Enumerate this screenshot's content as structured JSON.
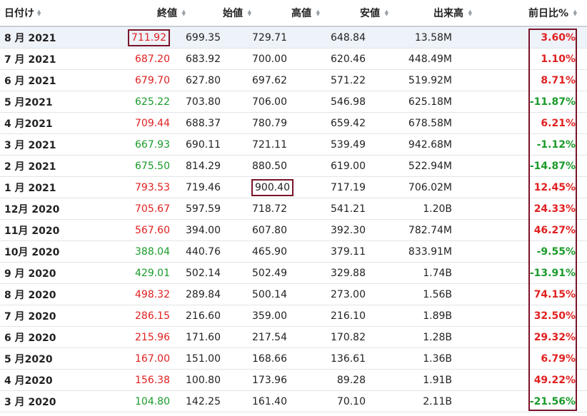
{
  "columns": {
    "date": "日付け",
    "close": "終値",
    "open": "始値",
    "high": "高値",
    "low": "安値",
    "volume": "出来高",
    "change": "前日比%"
  },
  "colors": {
    "up": "#e02020",
    "down": "#1a9a2a",
    "highlight_box": "#7a1428"
  },
  "rows": [
    {
      "date": "8 月 2021",
      "close": "711.92",
      "open": "699.35",
      "high": "729.71",
      "low": "648.84",
      "volume": "13.58M",
      "change": "3.60%",
      "dir": "up"
    },
    {
      "date": "7 月 2021",
      "close": "687.20",
      "open": "683.92",
      "high": "700.00",
      "low": "620.46",
      "volume": "448.49M",
      "change": "1.10%",
      "dir": "up"
    },
    {
      "date": "6 月 2021",
      "close": "679.70",
      "open": "627.80",
      "high": "697.62",
      "low": "571.22",
      "volume": "519.92M",
      "change": "8.71%",
      "dir": "up"
    },
    {
      "date": "5 月2021",
      "close": "625.22",
      "open": "703.80",
      "high": "706.00",
      "low": "546.98",
      "volume": "625.18M",
      "change": "-11.87%",
      "dir": "down"
    },
    {
      "date": "4 月2021",
      "close": "709.44",
      "open": "688.37",
      "high": "780.79",
      "low": "659.42",
      "volume": "678.58M",
      "change": "6.21%",
      "dir": "up"
    },
    {
      "date": "3 月 2021",
      "close": "667.93",
      "open": "690.11",
      "high": "721.11",
      "low": "539.49",
      "volume": "942.68M",
      "change": "-1.12%",
      "dir": "down"
    },
    {
      "date": "2 月 2021",
      "close": "675.50",
      "open": "814.29",
      "high": "880.50",
      "low": "619.00",
      "volume": "522.94M",
      "change": "-14.87%",
      "dir": "down"
    },
    {
      "date": "1 月 2021",
      "close": "793.53",
      "open": "719.46",
      "high": "900.40",
      "low": "717.19",
      "volume": "706.02M",
      "change": "12.45%",
      "dir": "up"
    },
    {
      "date": "12月 2020",
      "close": "705.67",
      "open": "597.59",
      "high": "718.72",
      "low": "541.21",
      "volume": "1.20B",
      "change": "24.33%",
      "dir": "up"
    },
    {
      "date": "11月 2020",
      "close": "567.60",
      "open": "394.00",
      "high": "607.80",
      "low": "392.30",
      "volume": "782.74M",
      "change": "46.27%",
      "dir": "up"
    },
    {
      "date": "10月 2020",
      "close": "388.04",
      "open": "440.76",
      "high": "465.90",
      "low": "379.11",
      "volume": "833.91M",
      "change": "-9.55%",
      "dir": "down"
    },
    {
      "date": "9 月 2020",
      "close": "429.01",
      "open": "502.14",
      "high": "502.49",
      "low": "329.88",
      "volume": "1.74B",
      "change": "-13.91%",
      "dir": "down"
    },
    {
      "date": "8 月 2020",
      "close": "498.32",
      "open": "289.84",
      "high": "500.14",
      "low": "273.00",
      "volume": "1.56B",
      "change": "74.15%",
      "dir": "up"
    },
    {
      "date": "7 月 2020",
      "close": "286.15",
      "open": "216.60",
      "high": "359.00",
      "low": "216.10",
      "volume": "1.89B",
      "change": "32.50%",
      "dir": "up"
    },
    {
      "date": "6 月 2020",
      "close": "215.96",
      "open": "171.60",
      "high": "217.54",
      "low": "170.82",
      "volume": "1.28B",
      "change": "29.32%",
      "dir": "up"
    },
    {
      "date": "5 月2020",
      "close": "167.00",
      "open": "151.00",
      "high": "168.66",
      "low": "136.61",
      "volume": "1.36B",
      "change": "6.79%",
      "dir": "up"
    },
    {
      "date": "4 月2020",
      "close": "156.38",
      "open": "100.80",
      "high": "173.96",
      "low": "89.28",
      "volume": "1.91B",
      "change": "49.22%",
      "dir": "up"
    },
    {
      "date": "3 月 2020",
      "close": "104.80",
      "open": "142.25",
      "high": "161.40",
      "low": "70.10",
      "volume": "2.11B",
      "change": "-21.56%",
      "dir": "down"
    }
  ]
}
